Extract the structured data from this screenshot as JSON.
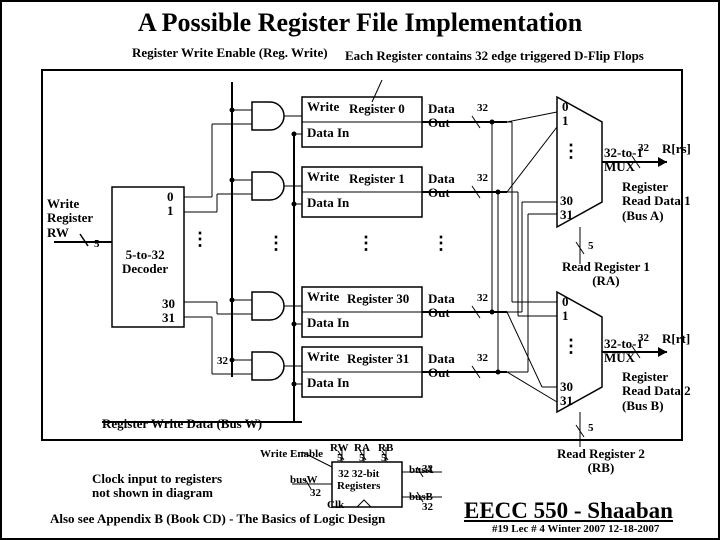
{
  "title": "A Possible Register File Implementation",
  "reg_write_enable": "Register Write Enable (Reg. Write)",
  "note_flops": "Each Register contains 32 edge triggered D-Flip Flops",
  "write_register_rw": "Write\nRegister\nRW",
  "rw_width": "5",
  "decoder": "5-to-32\nDecoder",
  "decoder_top": "0\n1",
  "decoder_bot": "30\n31",
  "dec_out32": "32",
  "reg0": {
    "name": "Register 0",
    "write": "Write",
    "datain": "Data In",
    "dataout": "Data\nOut",
    "bus": "32"
  },
  "reg1": {
    "name": "Register 1",
    "write": "Write",
    "datain": "Data In",
    "dataout": "Data\nOut",
    "bus": "32"
  },
  "reg30": {
    "name": "Register 30",
    "write": "Write",
    "datain": "Data In",
    "dataout": "Data\nOut",
    "bus": "32"
  },
  "reg31": {
    "name": "Register 31",
    "write": "Write",
    "datain": "Data In",
    "dataout": "Data\nOut",
    "bus": "32"
  },
  "mux1": {
    "name": "32-to-1\nMUX",
    "top": "0\n1",
    "bot": "30\n31",
    "out": "R[rs]",
    "outw": "32",
    "desc": "Register\nRead Data 1\n(Bus A)",
    "sel": "5",
    "read": "Read Register 1\n(RA)"
  },
  "mux2": {
    "name": "32-to-1\nMUX",
    "top": "0\n1",
    "bot": "30\n31",
    "out": "R[rt]",
    "outw": "32",
    "desc": "Register\nRead Data 2\n(Bus B)",
    "sel": "5",
    "read": "Read Register 2\n(RB)"
  },
  "reg_write_data": "Register Write Data  (Bus W)",
  "clock_note": "Clock input to registers\nnot shown in diagram",
  "mini": {
    "we": "Write Enable",
    "rw": "RW",
    "ra": "RA",
    "rb": "RB",
    "busW": "busW",
    "busA": "busA",
    "busB": "busB",
    "w32a": "32",
    "w32b": "32",
    "w32c": "32",
    "w32d": "32",
    "w5a": "5",
    "w5b": "5",
    "w5c": "5",
    "name": "32 32-bit\nRegisters",
    "clk": "Clk"
  },
  "appendix": "Also see Appendix B (Book CD) - The Basics of Logic Design",
  "course": "EECC 550 - Shaaban",
  "footer": "#19    Lec # 4   Winter 2007   12-18-2007",
  "dots": "⋮"
}
